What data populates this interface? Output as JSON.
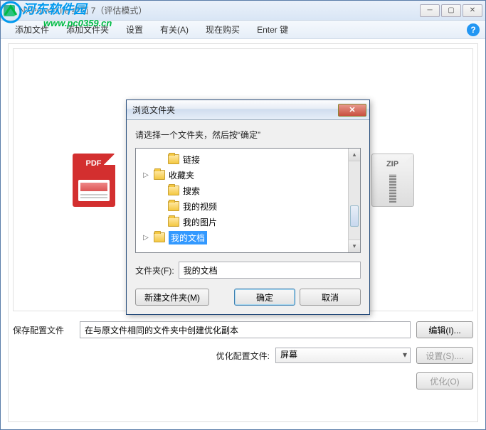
{
  "window": {
    "title": "NXPowerLite 桌面 7（评估模式）"
  },
  "menu": {
    "add_file": "添加文件",
    "add_folder": "添加文件夹",
    "settings": "设置",
    "about": "有关(A)",
    "buy_now": "现在购买",
    "enter_key": "Enter 键"
  },
  "watermark": {
    "line1": "河东软件园",
    "line2": "www.pc0359.cn"
  },
  "form": {
    "save_profile_label": "保存配置文件",
    "save_profile_value": "在与原文件相同的文件夹中创建优化副本",
    "edit_btn": "编辑(I)...",
    "opt_profile_label": "优化配置文件:",
    "opt_profile_value": "屏幕",
    "settings_btn": "设置(S)....",
    "optimize_btn": "优化(O)"
  },
  "dialog": {
    "title": "浏览文件夹",
    "instruction": "请选择一个文件夹，然后按“确定”",
    "tree": [
      {
        "label": "链接",
        "expander": "",
        "indent": 1
      },
      {
        "label": "收藏夹",
        "expander": "▷",
        "indent": 0
      },
      {
        "label": "搜索",
        "expander": "",
        "indent": 1
      },
      {
        "label": "我的视频",
        "expander": "",
        "indent": 1
      },
      {
        "label": "我的图片",
        "expander": "",
        "indent": 1
      },
      {
        "label": "我的文档",
        "expander": "▷",
        "indent": 0,
        "selected": true
      }
    ],
    "folder_label": "文件夹(F):",
    "folder_value": "我的文档",
    "new_folder_btn": "新建文件夹(M)",
    "ok_btn": "确定",
    "cancel_btn": "取消"
  }
}
